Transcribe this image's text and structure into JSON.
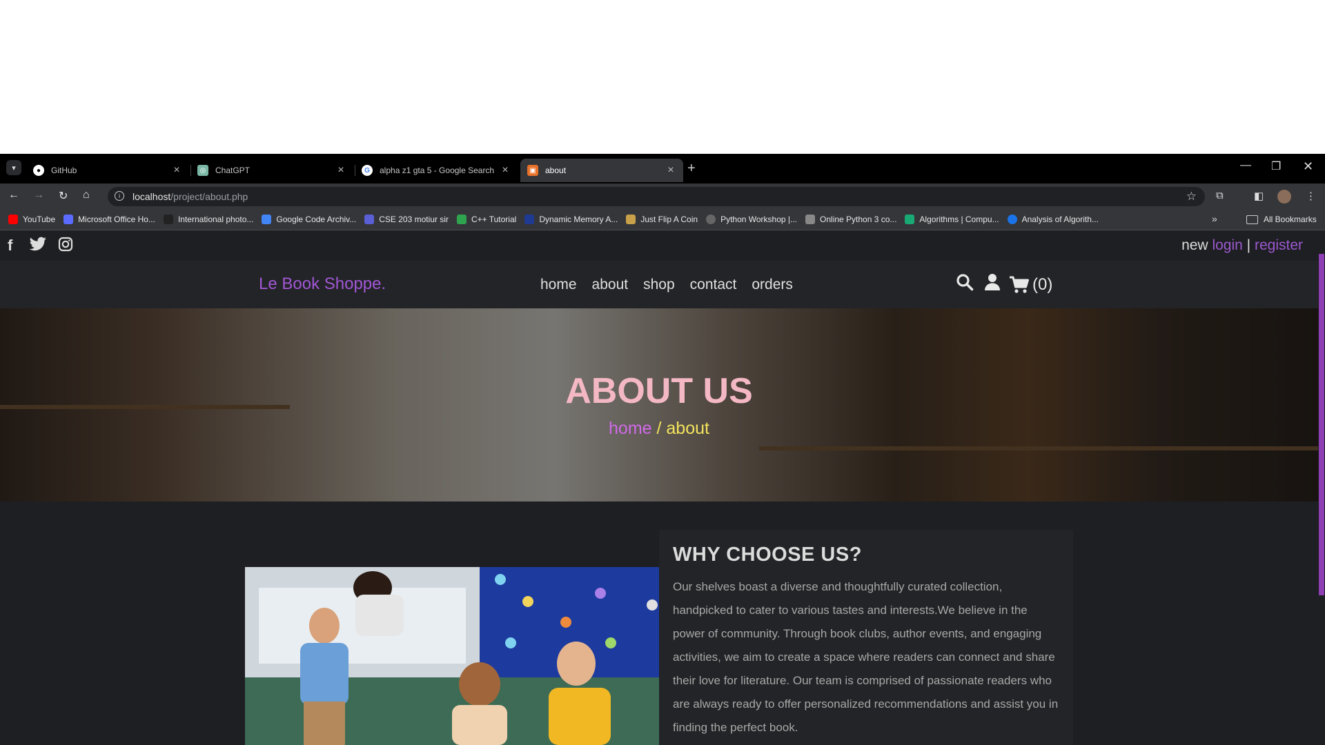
{
  "browser": {
    "tabs": [
      {
        "title": "GitHub",
        "close": "×"
      },
      {
        "title": "ChatGPT",
        "close": "×"
      },
      {
        "title": "alpha z1 gta 5 - Google Search",
        "close": "×"
      },
      {
        "title": "about",
        "close": "×"
      }
    ],
    "new_tab": "+",
    "url_host": "localhost",
    "url_path": "/project/about.php",
    "bookmarks": [
      {
        "label": "YouTube",
        "color": "#ff0000"
      },
      {
        "label": "Microsoft Office Ho...",
        "color": "#5b6bff"
      },
      {
        "label": "International photo...",
        "color": "#222222"
      },
      {
        "label": "Google Code Archiv...",
        "color": "#4285f4"
      },
      {
        "label": "CSE 203 motiur sir",
        "color": "#5a5fd6"
      },
      {
        "label": "C++ Tutorial",
        "color": "#2ea44f"
      },
      {
        "label": "Dynamic Memory A...",
        "color": "#1f3a93"
      },
      {
        "label": "Just Flip A Coin",
        "color": "#c9a04a"
      },
      {
        "label": "Python Workshop |...",
        "color": "#666666"
      },
      {
        "label": "Online Python 3 co...",
        "color": "#888888"
      },
      {
        "label": "Algorithms | Compu...",
        "color": "#19a974"
      },
      {
        "label": "Analysis of Algorith...",
        "color": "#1a73e8"
      }
    ],
    "bookmarks_more": "»",
    "all_bookmarks": "All Bookmarks"
  },
  "site": {
    "auth": {
      "prefix": "new",
      "login": "login",
      "sep": "|",
      "register": "register"
    },
    "logo": "Le Book Shoppe.",
    "nav": [
      "home",
      "about",
      "shop",
      "contact",
      "orders"
    ],
    "cart_count": "(0)",
    "hero": {
      "title": "ABOUT US",
      "crumb_home": "home",
      "crumb_current": " / about"
    },
    "about": {
      "heading": "WHY CHOOSE US?",
      "body": "Our shelves boast a diverse and thoughtfully curated collection, handpicked to cater to various tastes and interests.We believe in the power of community. Through book clubs, author events, and engaging activities, we aim to create a space where readers can connect and share their love for literature. Our team is comprised of passionate readers who are always ready to offer personalized recommendations and assist you in finding the perfect book."
    },
    "colors": {
      "accent": "#9b59d0",
      "hero_title": "#f4b8c4",
      "crumb_current": "#f3e35c"
    }
  }
}
